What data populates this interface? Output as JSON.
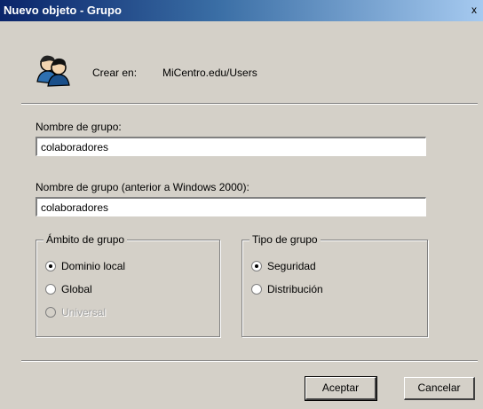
{
  "window": {
    "title": "Nuevo objeto - Grupo",
    "close_glyph": "x"
  },
  "header": {
    "icon": "group-icon",
    "create_label": "Crear en:",
    "create_path": "MiCentro.edu/Users"
  },
  "form": {
    "group_name_label": "Nombre de grupo:",
    "group_name_value": "colaboradores",
    "legacy_name_label": "Nombre de grupo (anterior a Windows 2000):",
    "legacy_name_value": "colaboradores"
  },
  "scope": {
    "title": "Ámbito de grupo",
    "options": [
      {
        "label": "Dominio local",
        "selected": true,
        "enabled": true
      },
      {
        "label": "Global",
        "selected": false,
        "enabled": true
      },
      {
        "label": "Universal",
        "selected": false,
        "enabled": false
      }
    ]
  },
  "type": {
    "title": "Tipo de grupo",
    "options": [
      {
        "label": "Seguridad",
        "selected": true
      },
      {
        "label": "Distribución",
        "selected": false
      }
    ]
  },
  "buttons": {
    "ok": "Aceptar",
    "cancel": "Cancelar"
  }
}
